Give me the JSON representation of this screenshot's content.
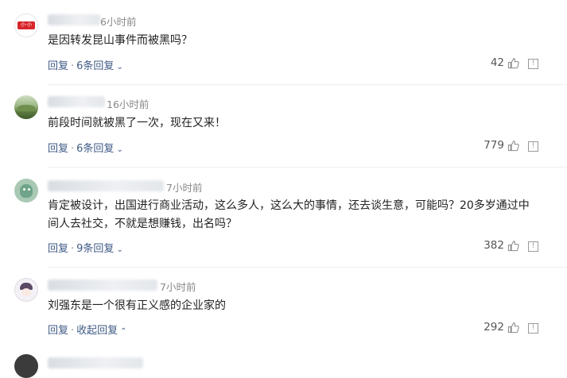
{
  "comments": [
    {
      "time": "6小时前",
      "text": "是因转发昆山事件而被黑吗？",
      "reply": "回复",
      "sep": "·",
      "replies": "6条回复",
      "likes": "42",
      "avatar": "avatar-logo",
      "avatar_text": "小·小"
    },
    {
      "time": "16小时前",
      "text": "前段时间就被黑了一次，现在又来！",
      "reply": "回复",
      "sep": "·",
      "replies": "6条回复",
      "likes": "779",
      "avatar": "avatar-landscape"
    },
    {
      "time": "7小时前",
      "text": "肯定被设计，出国进行商业活动，这么多人，这么大的事情，还去谈生意，可能吗？20多岁通过中间人去社交，不就是想赚钱，出名吗？",
      "reply": "回复",
      "sep": "·",
      "replies": "9条回复",
      "likes": "382",
      "avatar": "avatar-character"
    },
    {
      "time": "7小时前",
      "text": "刘强东是一个很有正义感的企业家的",
      "reply": "回复",
      "sep": "·",
      "replies": "收起回复",
      "likes": "292",
      "avatar": "avatar-sketch"
    }
  ],
  "icons": {
    "expand": "chevron-down-icon",
    "collapse": "chevron-up-icon",
    "like": "thumbs-up-icon",
    "report": "report-icon"
  },
  "colors": {
    "link": "#405b86",
    "muted": "#888888",
    "divider": "#eeeeee"
  }
}
